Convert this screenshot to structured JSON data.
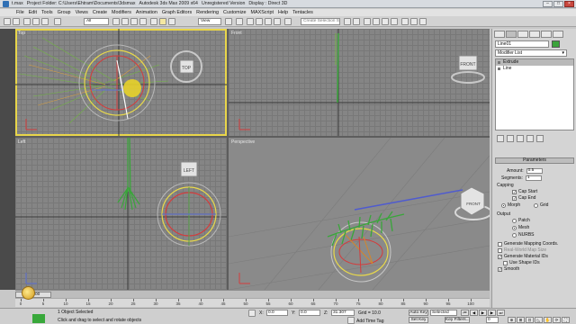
{
  "titlebar": {
    "segments": [
      "t.max",
      "Project Folder: C:\\Users\\Ehtram\\Documents\\3dsmax",
      "Autodesk 3ds Max 2009 x64",
      "Unregistered Version",
      "Display : Direct 3D"
    ],
    "minimize": "–",
    "maximize": "□",
    "close": "×"
  },
  "menubar": {
    "items": [
      "File",
      "Edit",
      "Tools",
      "Group",
      "Views",
      "Create",
      "Modifiers",
      "Animation",
      "Graph Editors",
      "Rendering",
      "Customize",
      "MAXScript",
      "Help",
      "Tentacles"
    ]
  },
  "toolbar": {
    "selection_filter": "All",
    "reference_coord": "View",
    "named_selection_placeholder": "Create Selection Set"
  },
  "viewports": {
    "top_label": "Top",
    "front_label": "Front",
    "left_label": "Left",
    "persp_label": "Perspective",
    "viewcube_top": "TOP",
    "viewcube_front": "FRONT",
    "viewcube_left": "LEFT",
    "viewcube_persp": "FRONT"
  },
  "command_panel": {
    "object_name": "Line01",
    "object_color": "#3aa33a",
    "modifier_list": "Modifier List",
    "stack": [
      "Extrude",
      "Line"
    ],
    "rollout_title": "Parameters",
    "amount_label": "Amount:",
    "amount_value": "0.5",
    "segments_label": "Segments:",
    "segments_value": "1",
    "capping_label": "Capping",
    "cap_start": "Cap Start",
    "cap_end": "Cap End",
    "morph": "Morph",
    "grid": "Grid",
    "output_label": "Output",
    "patch": "Patch",
    "mesh": "Mesh",
    "nurbs": "NURBS",
    "gen_mapping": "Generate Mapping Coords.",
    "real_world": "Real-World Map Size",
    "gen_material": "Generate Material IDs",
    "use_shape_ids": "Use Shape IDs",
    "smooth": "Smooth"
  },
  "timeline": {
    "slider": "0 / 100",
    "ticks": [
      "0",
      "5",
      "10",
      "15",
      "20",
      "25",
      "30",
      "35",
      "40",
      "45",
      "50",
      "55",
      "60",
      "65",
      "70",
      "75",
      "80",
      "85",
      "90",
      "95",
      "100"
    ]
  },
  "status": {
    "selection": "1 Object Selected",
    "prompt": "Click and drag to select and rotate objects",
    "x_value": "0.0",
    "y_value": "0.0",
    "z_value": "31.307",
    "grid": "Grid = 10.0",
    "add_time_tag": "Add Time Tag",
    "auto_key": "Auto Key",
    "set_key": "Set Key",
    "key_mode": "Selected",
    "key_filters": "Key Filters...",
    "frame": "0"
  }
}
